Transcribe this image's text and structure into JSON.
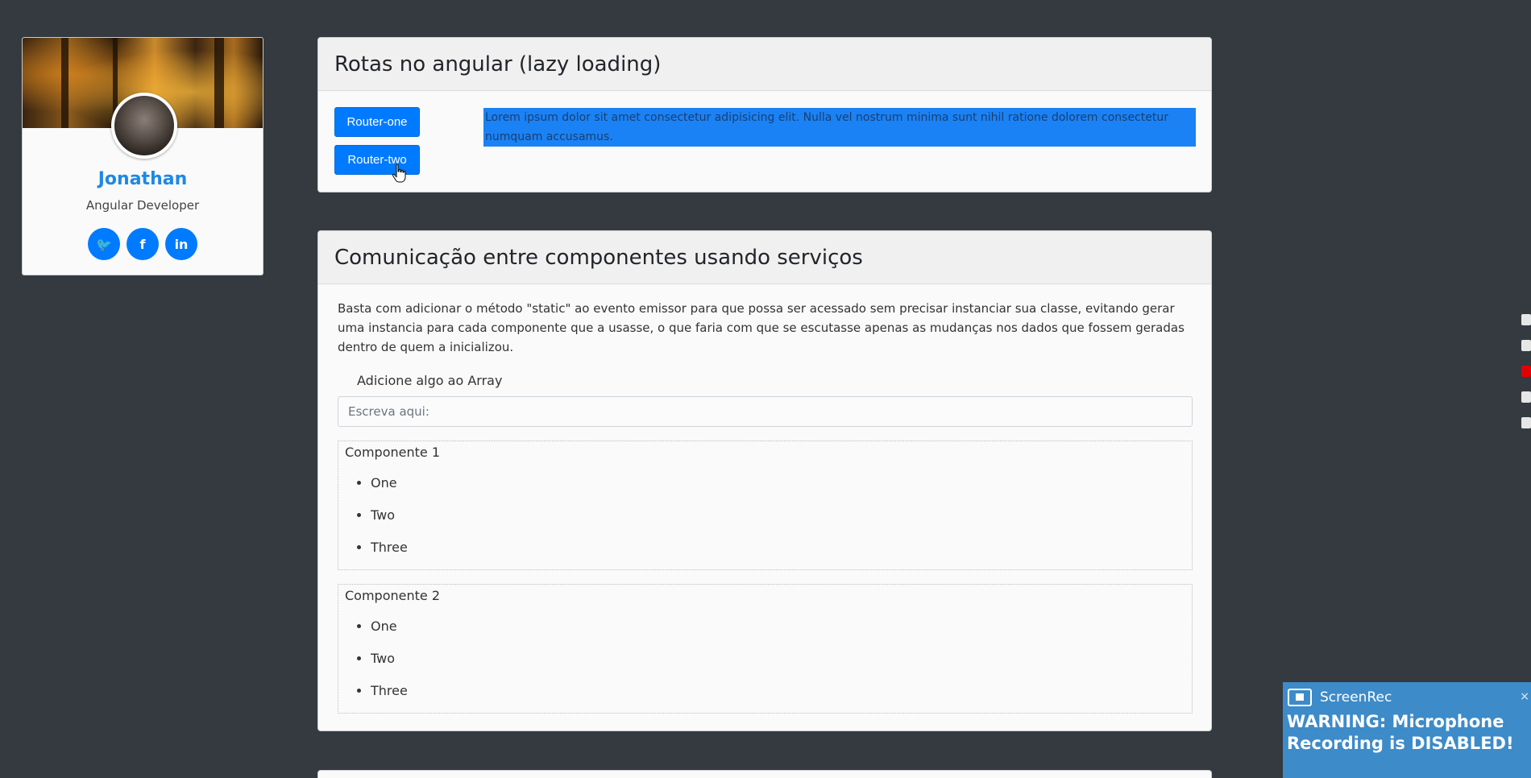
{
  "profile": {
    "name": "Jonathan",
    "role": "Angular Developer",
    "social": [
      {
        "icon": "twitter-icon",
        "glyph": "🐦"
      },
      {
        "icon": "facebook-icon",
        "glyph": "f"
      },
      {
        "icon": "linkedin-icon",
        "glyph": "in"
      }
    ]
  },
  "routes_panel": {
    "title": "Rotas no angular (lazy loading)",
    "buttons": [
      "Router-one",
      "Router-two"
    ],
    "content": "Lorem ipsum dolor sit amet consectetur adipisicing elit. Nulla vel nostrum minima sunt nihil ratione dolorem consectetur numquam accusamus."
  },
  "services_panel": {
    "title": "Comunicação entre componentes usando serviços",
    "description": "Basta com adicionar o método \"static\" ao evento emissor para que possa ser acessado sem precisar instanciar sua classe, evitando gerar uma instancia para cada componente que a usasse, o que faria com que se escutasse apenas as mudanças nos dados que fossem geradas dentro de quem a inicializou.",
    "array_label": "Adicione algo ao Array",
    "input_placeholder": "Escreva aqui:",
    "input_value": "",
    "components": [
      {
        "title": "Componente 1",
        "items": [
          "One",
          "Two",
          "Three"
        ]
      },
      {
        "title": "Componente 2",
        "items": [
          "One",
          "Two",
          "Three"
        ]
      }
    ]
  },
  "screenrec": {
    "brand": "ScreenRec",
    "close": "×",
    "warning": "WARNING: Microphone Recording is DISABLED!"
  },
  "colors": {
    "background": "#343a40",
    "primary": "#007bff",
    "name": "#1e88e5",
    "highlight": "#1a82f5",
    "screenrec": "#3d8bc9",
    "record": "#e30000"
  }
}
